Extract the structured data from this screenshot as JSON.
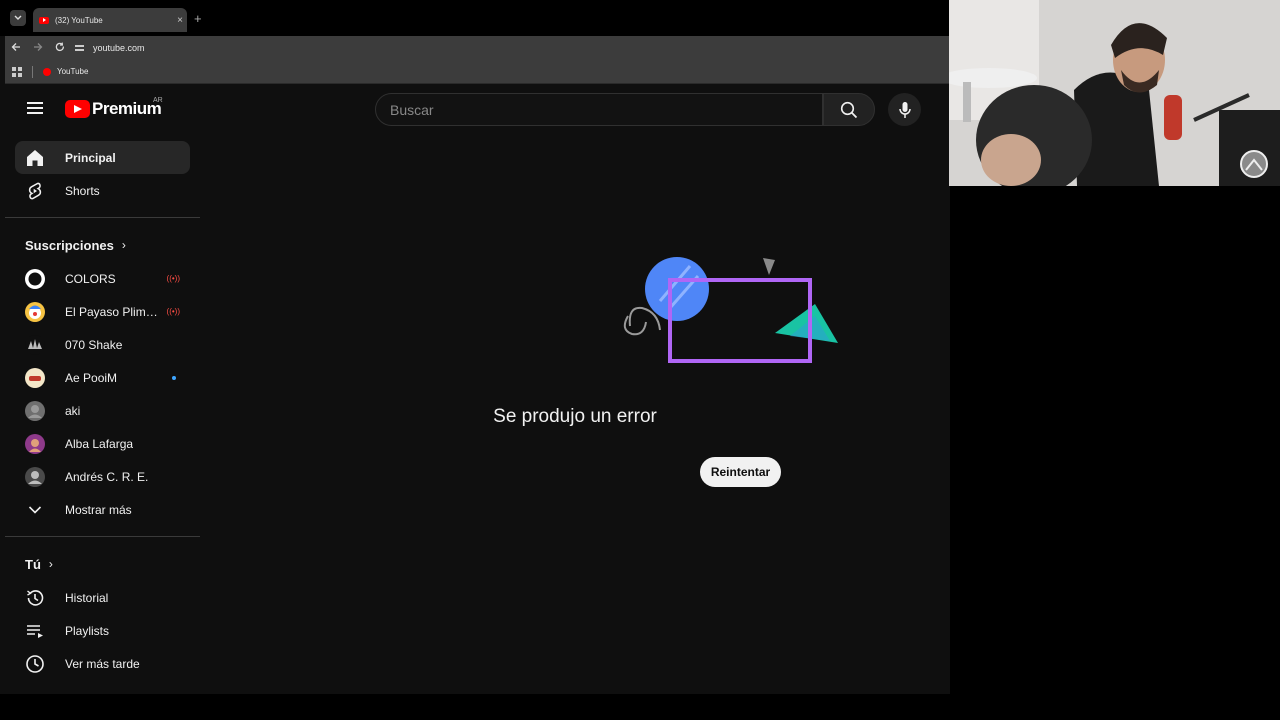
{
  "browser": {
    "tab_title": "(32) YouTube",
    "tab_close": "×",
    "new_tab": "+",
    "url": "youtube.com",
    "bookmark": "YouTube"
  },
  "header": {
    "logo_text": "Premium",
    "country_code": "AR",
    "search_placeholder": "Buscar"
  },
  "sidebar": {
    "main": [
      {
        "label": "Principal",
        "icon": "home-icon"
      },
      {
        "label": "Shorts",
        "icon": "shorts-icon"
      }
    ],
    "subscriptions_title": "Suscripciones",
    "subscriptions": [
      {
        "label": "COLORS",
        "status": "live"
      },
      {
        "label": "El Payaso Plim P...",
        "status": "live"
      },
      {
        "label": "070 Shake",
        "status": ""
      },
      {
        "label": "Ae PooiM",
        "status": "new"
      },
      {
        "label": "aki",
        "status": ""
      },
      {
        "label": "Alba Lafarga",
        "status": ""
      },
      {
        "label": "Andrés C. R. E.",
        "status": ""
      }
    ],
    "show_more": "Mostrar más",
    "you_title": "Tú",
    "you_items": [
      {
        "label": "Historial",
        "icon": "history-icon"
      },
      {
        "label": "Playlists",
        "icon": "playlists-icon"
      },
      {
        "label": "Ver más tarde",
        "icon": "watch-later-icon"
      }
    ]
  },
  "main": {
    "error_title": "Se produjo un error",
    "retry_label": "Reintentar"
  },
  "colors": {
    "brand_red": "#ff0000",
    "background": "#0f0f0f",
    "illustration_purple": "#b066f5",
    "illustration_blue": "#4f86f7",
    "illustration_teal": "#19c3a3"
  }
}
